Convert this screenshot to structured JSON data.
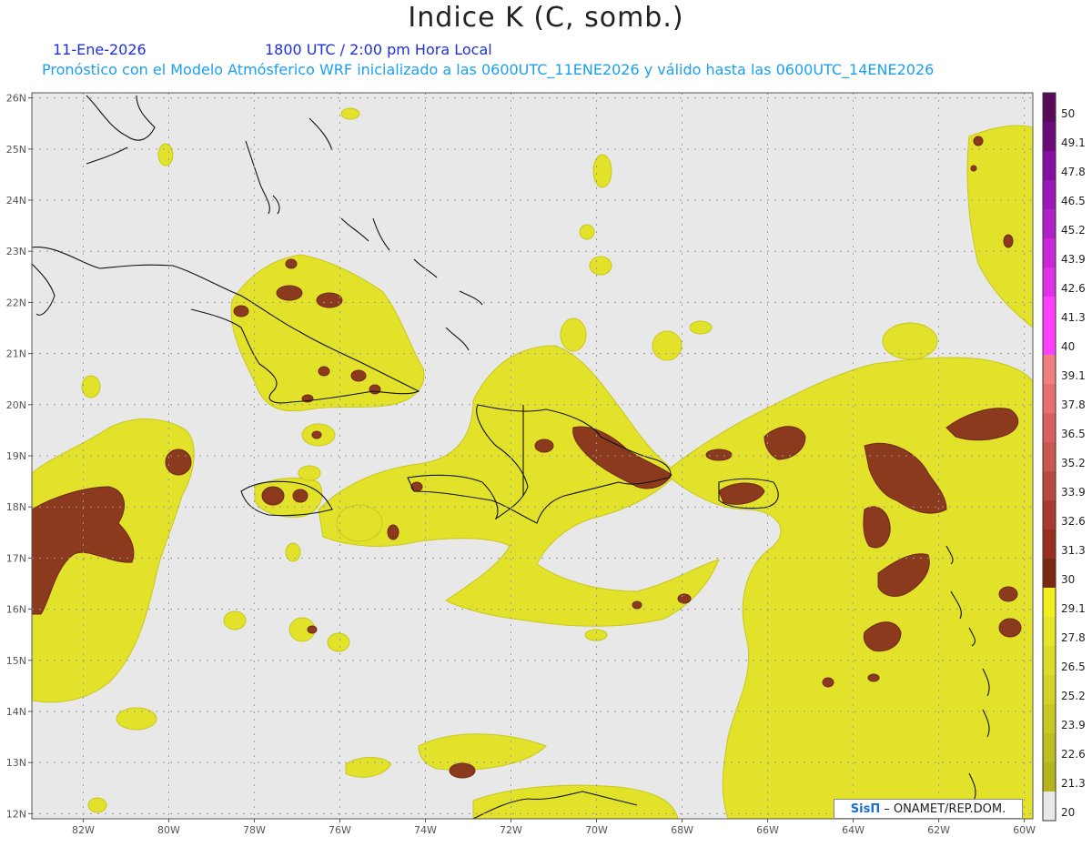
{
  "header": {
    "title": "Indice K (C, somb.)",
    "date": "11-Ene-2026",
    "time": "1800 UTC / 2:00 pm Hora Local",
    "description": "Pronóstico con el Modelo Atmósferico WRF inicializado a las 0600UTC_11ENE2026 y válido hasta las  0600UTC_14ENE2026"
  },
  "map": {
    "lon_labels": [
      "82W",
      "80W",
      "78W",
      "76W",
      "74W",
      "72W",
      "70W",
      "68W",
      "66W",
      "64W",
      "62W",
      "60W"
    ],
    "lat_labels": [
      "26N",
      "25N",
      "24N",
      "23N",
      "22N",
      "21N",
      "20N",
      "19N",
      "18N",
      "17N",
      "16N",
      "15N",
      "14N",
      "13N",
      "12N"
    ],
    "lon_range": [
      -83.2,
      -59.8
    ],
    "lat_range": [
      11.9,
      26.1
    ]
  },
  "legend": {
    "levels": [
      "50",
      "49.1",
      "47.8",
      "46.5",
      "45.2",
      "43.9",
      "42.6",
      "41.3",
      "40",
      "39.1",
      "37.8",
      "36.5",
      "35.2",
      "33.9",
      "32.6",
      "31.3",
      "30",
      "29.1",
      "27.8",
      "26.5",
      "25.2",
      "23.9",
      "22.6",
      "21.3",
      "20"
    ],
    "colors": [
      "#5a0a5a",
      "#6a0a7a",
      "#8410a0",
      "#9a18b8",
      "#b020c8",
      "#c826d8",
      "#e030e8",
      "#ff40ff",
      "#ff40ff",
      "#f08080",
      "#e87070",
      "#d86060",
      "#c85850",
      "#b84a40",
      "#a83a30",
      "#983020",
      "#7a2810",
      "#f0f020",
      "#e6e628",
      "#dcdc2a",
      "#d2d228",
      "#c8c822",
      "#bebe20",
      "#b4b41e",
      "#e8e8e8"
    ]
  },
  "attribution": {
    "logo": "SisΠ",
    "text": "– ONAMET/REP.DOM."
  }
}
